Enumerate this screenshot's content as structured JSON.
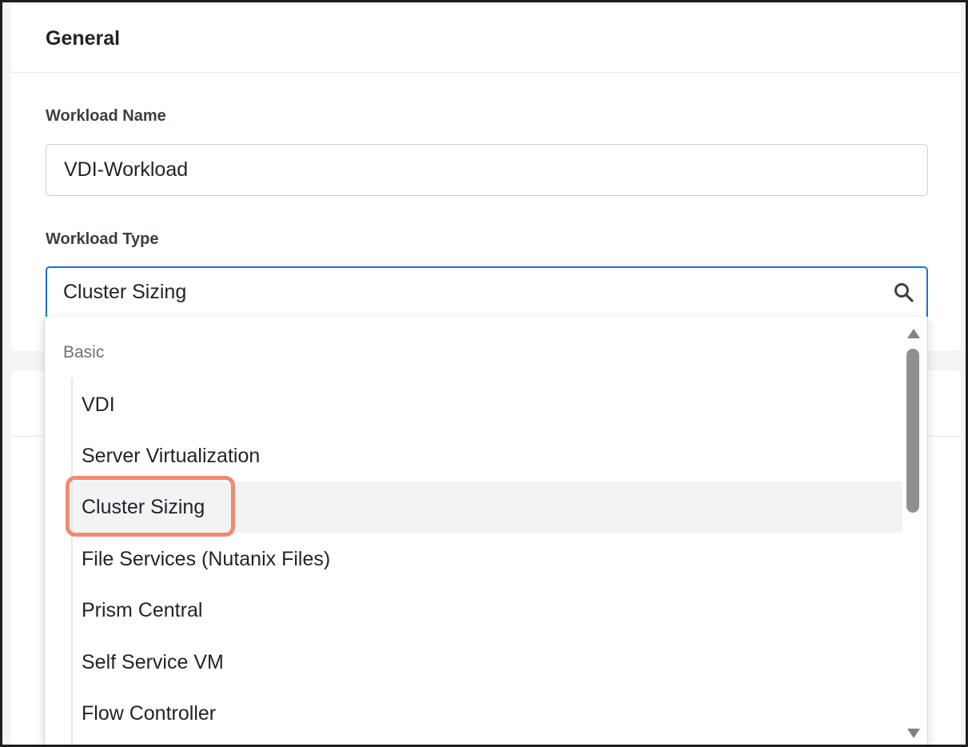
{
  "general_section": {
    "title": "General"
  },
  "workload_name": {
    "label": "Workload Name",
    "value": "VDI-Workload"
  },
  "workload_type": {
    "label": "Workload Type",
    "value": "Cluster Sizing",
    "search_icon": "search-icon"
  },
  "dropdown": {
    "group_label": "Basic",
    "options": [
      "VDI",
      "Server Virtualization",
      "Cluster Sizing",
      "File Services (Nutanix Files)",
      "Prism Central",
      "Self Service VM",
      "Flow Controller"
    ],
    "selected": "Cluster Sizing"
  },
  "colors": {
    "focus_border": "#1f6fd1",
    "highlight": "#f08a6f",
    "scroll_thumb": "#8d9196"
  }
}
